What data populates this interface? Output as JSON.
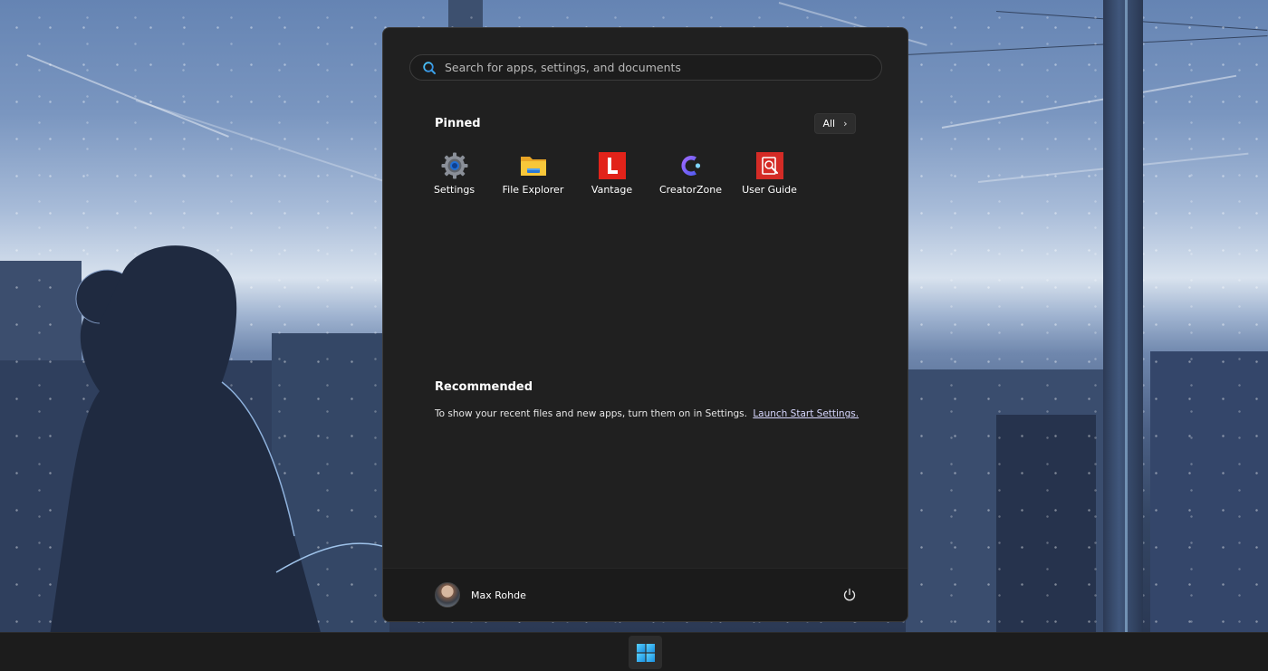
{
  "search": {
    "placeholder": "Search for apps, settings, and documents"
  },
  "pinned": {
    "title": "Pinned",
    "all_label": "All",
    "apps": [
      {
        "label": "Settings",
        "icon": "gear-icon"
      },
      {
        "label": "File Explorer",
        "icon": "folder-icon"
      },
      {
        "label": "Vantage",
        "icon": "lenovo-vantage-icon"
      },
      {
        "label": "CreatorZone",
        "icon": "creatorzone-icon"
      },
      {
        "label": "User Guide",
        "icon": "user-guide-icon"
      }
    ]
  },
  "recommended": {
    "title": "Recommended",
    "message": "To show your recent files and new apps, turn them on in Settings.",
    "link_label": "Launch Start Settings."
  },
  "user": {
    "name": "Max Rohde"
  },
  "colors": {
    "menu_background": "#202020",
    "footer_background": "#1b1b1b",
    "taskbar_background": "#1c1c1c",
    "windows_logo": "#3ab4f2",
    "vantage_red": "#e2231a",
    "user_guide_red": "#d42b26",
    "folder_yellow": "#f8c73a"
  }
}
